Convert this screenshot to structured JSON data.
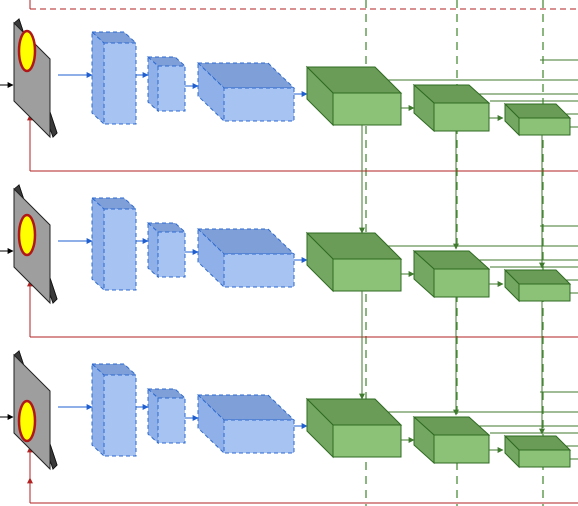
{
  "colors": {
    "frame_front": "#9e9e9e",
    "frame_side": "#3a3a3a",
    "ellipse_fill": "#ffff00",
    "ellipse_stroke": "#b01818",
    "blue_front": "#a6c3f2",
    "blue_top": "#7f9fd8",
    "blue_side": "#8fb0e8",
    "blue_stroke": "#2d6ad0",
    "blue_arrow": "#1f5fd0",
    "green_front": "#8cc178",
    "green_top": "#6a9c57",
    "green_side": "#74a862",
    "green_stroke": "#2f6b22",
    "green_line": "#3f7a2e",
    "dash_green": "#4f8f3c",
    "red_line": "#b22222",
    "black_arrow": "#000000"
  },
  "rows": [
    {
      "id": "row-1",
      "ellipse": "upper"
    },
    {
      "id": "row-2",
      "ellipse": "middle"
    },
    {
      "id": "row-3",
      "ellipse": "lower"
    }
  ]
}
